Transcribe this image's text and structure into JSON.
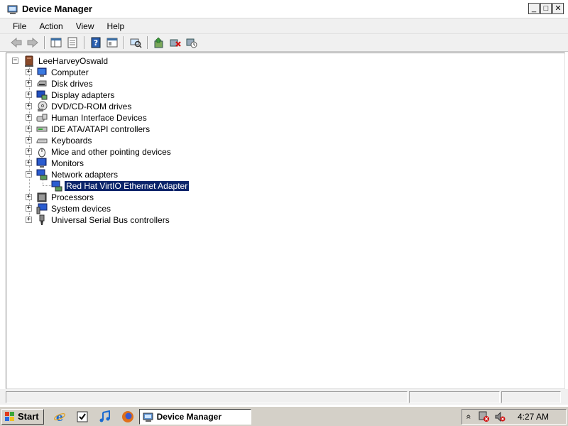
{
  "window": {
    "title": "Device Manager",
    "minimize": "_",
    "maximize": "□",
    "close": "✕"
  },
  "menu": [
    {
      "label": "File"
    },
    {
      "label": "Action"
    },
    {
      "label": "View"
    },
    {
      "label": "Help"
    }
  ],
  "toolbar": {
    "buttons": [
      "back-icon",
      "forward-icon",
      "show-hide-tree-icon",
      "properties-icon",
      "help-icon",
      "view-icon",
      "scan-hardware-icon",
      "update-driver-icon",
      "uninstall-icon",
      "disable-device-icon"
    ]
  },
  "tree": {
    "root": "LeeHarveyOswald",
    "categories": [
      {
        "label": "Computer",
        "icon": "computer-icon",
        "expander": "+"
      },
      {
        "label": "Disk drives",
        "icon": "disk-drive-icon",
        "expander": "+"
      },
      {
        "label": "Display adapters",
        "icon": "display-adapter-icon",
        "expander": "+"
      },
      {
        "label": "DVD/CD-ROM drives",
        "icon": "dvd-drive-icon",
        "expander": "+"
      },
      {
        "label": "Human Interface Devices",
        "icon": "hid-icon",
        "expander": "+"
      },
      {
        "label": "IDE ATA/ATAPI controllers",
        "icon": "ide-controller-icon",
        "expander": "+"
      },
      {
        "label": "Keyboards",
        "icon": "keyboard-icon",
        "expander": "+"
      },
      {
        "label": "Mice and other pointing devices",
        "icon": "mouse-icon",
        "expander": "+"
      },
      {
        "label": "Monitors",
        "icon": "monitor-icon",
        "expander": "+"
      },
      {
        "label": "Network adapters",
        "icon": "network-adapter-icon",
        "expander": "−"
      },
      {
        "label": "Processors",
        "icon": "processor-icon",
        "expander": "+"
      },
      {
        "label": "System devices",
        "icon": "system-devices-icon",
        "expander": "+"
      },
      {
        "label": "Universal Serial Bus controllers",
        "icon": "usb-icon",
        "expander": "+"
      }
    ],
    "network_child": "Red Hat VirtIO Ethernet Adapter",
    "root_expander": "−"
  },
  "taskbar": {
    "start": "Start",
    "task": "Device Manager",
    "clock": "4:27 AM",
    "tray_chevron": "«"
  },
  "colors": {
    "selection": "#0a246a",
    "chrome": "#f0f0f0",
    "taskbar": "#d4d0c8"
  }
}
